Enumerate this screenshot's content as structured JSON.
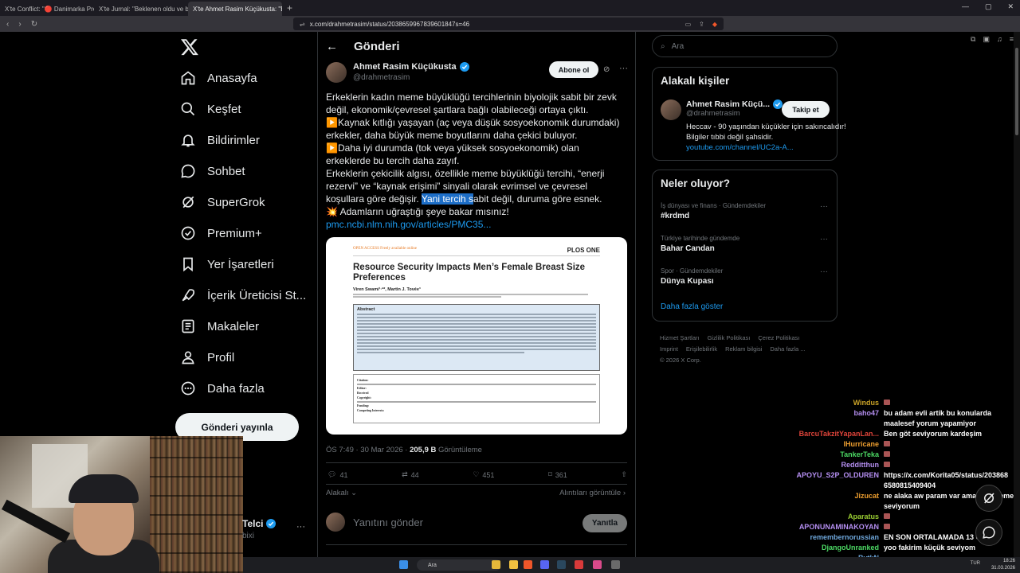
{
  "browser": {
    "tabs": [
      {
        "label": "X'te Conflict: \"🔴 Danimarka Prenses..."
      },
      {
        "label": "X'te Jurnal: \"Beklenen oldu ve buza..."
      },
      {
        "label": "X'te Ahmet Rasim Küçükusta: \"E..."
      }
    ],
    "url": "x.com/drahmetrasim/status/2038659967839601847s=46"
  },
  "sidebar": {
    "items": [
      {
        "label": "Anasayfa",
        "icon": "home-icon"
      },
      {
        "label": "Keşfet",
        "icon": "search-icon"
      },
      {
        "label": "Bildirimler",
        "icon": "bell-icon"
      },
      {
        "label": "Sohbet",
        "icon": "chat-icon"
      },
      {
        "label": "SuperGrok",
        "icon": "grok-icon"
      },
      {
        "label": "Premium+",
        "icon": "premium-icon"
      },
      {
        "label": "Yer İşaretleri",
        "icon": "bookmark-icon"
      },
      {
        "label": "İçerik Üreticisi St...",
        "icon": "rocket-icon"
      },
      {
        "label": "Makaleler",
        "icon": "article-icon"
      },
      {
        "label": "Profil",
        "icon": "person-icon"
      },
      {
        "label": "Daha fazla",
        "icon": "more-circle-icon"
      }
    ],
    "post_button": "Gönderi yayınla",
    "account_name": "Telci",
    "account_handle": "bixi"
  },
  "post": {
    "header_title": "Gönderi",
    "author_name": "Ahmet Rasim Küçükusta",
    "author_handle": "@drahmetrasim",
    "subscribe_label": "Abone ol",
    "text": {
      "p1": "Erkeklerin kadın meme büyüklüğü tercihlerinin biyolojik sabit bir zevk değil, ekonomik/çevresel şartlara bağlı olabileceği ortaya çıktı.",
      "p2": "Kaynak kıtlığı yaşayan (aç veya düşük sosyoekonomik durumdaki) erkekler, daha büyük meme boyutlarını daha çekici buluyor.",
      "p3": "Daha iyi durumda (tok veya yüksek sosyoekonomik) olan erkeklerde bu tercih daha zayıf.",
      "p4a": "Erkeklerin çekicilik algısı, özellikle meme büyüklüğü tercihi, “enerji rezervi” ve “kaynak erişimi” sinyali olarak evrimsel ve çevresel koşullara göre değişir. ",
      "p4hl": "Yani tercih s",
      "p4b": "abit değil, duruma göre esnek.",
      "p5": "Adamların uğraştığı şeye bakar mısınız!",
      "link": "pmc.ncbi.nlm.nih.gov/articles/PMC35..."
    },
    "paper": {
      "open_access": "OPEN ACCESS Freely available online",
      "journal": "PLOS ONE",
      "title": "Resource Security Impacts Men’s Female Breast Size Preferences",
      "authors": "Viren Swami¹·²*, Martin J. Tovée³",
      "abstract_heading": "Abstract",
      "meta": [
        "Citation:",
        "Editor:",
        "Received",
        "Copyright:",
        "Funding:",
        "Competing Interests:"
      ]
    },
    "timestamp": "ÖS 7:49 · 30 Mar 2026 · ",
    "views_value": "205,9 B",
    "views_label": " Görüntüleme",
    "stats": {
      "replies": "41",
      "reposts": "44",
      "likes": "451",
      "bookmarks": "361"
    },
    "relevant_label": "Alakalı",
    "quotes_label": "Alıntıları görüntüle",
    "reply_placeholder": "Yanıtını gönder",
    "reply_button": "Yanıtla"
  },
  "right": {
    "search_placeholder": "Ara",
    "relevant_title": "Alakalı kişiler",
    "person_name": "Ahmet Rasim Küçü...",
    "person_handle": "@drahmetrasim",
    "follow_label": "Takip et",
    "bio": "Heccav - 90 yaşından küçükler için sakıncalıdır! Bilgiler tıbbi değil şahsidir.",
    "bio_link": "youtube.com/channel/UC2a-A...",
    "trends_title": "Neler oluyor?",
    "trends": [
      {
        "category": "İş dünyası ve finans · Gündemdekiler",
        "title": "#krdmd"
      },
      {
        "category": "Türkiye tarihinde gündemde",
        "title": "Bahar Candan"
      },
      {
        "category": "Spor · Gündemdekiler",
        "title": "Dünya Kupası"
      }
    ],
    "show_more": "Daha fazla göster",
    "footer": [
      "Hizmet Şartları",
      "Gizlilik Politikası",
      "Çerez Politikası",
      "Imprint",
      "Erişilebilirlik",
      "Reklam bilgisi",
      "Daha fazla ...",
      "© 2026 X Corp."
    ]
  },
  "chat": [
    {
      "user": "Windus",
      "msg": "",
      "color": "#c9a227",
      "emote": true
    },
    {
      "user": "baho47",
      "msg": "bu adam evli artik bu konularda maalesef yorum yapamiyor",
      "color": "#b48ef0"
    },
    {
      "user": "BarcuTakzitYapanLan...",
      "msg": "Ben göt seviyorum kardeşim",
      "color": "#e0443a"
    },
    {
      "user": "lHurricane",
      "msg": "",
      "color": "#f0a030",
      "emote": true
    },
    {
      "user": "TankerTeka",
      "msg": "",
      "color": "#4cd964",
      "emote": true
    },
    {
      "user": "Redditthun",
      "msg": "",
      "color": "#b48ef0",
      "emote": true
    },
    {
      "user": "APOYU_S2P_OLDUREN",
      "msg": "https://x.com/Korita05/status/203868 6580815409404",
      "color": "#b48ef0"
    },
    {
      "user": "Jizucat",
      "msg": "ne alaka aw param var ama ben meme seviyorum",
      "color": "#f0a030"
    },
    {
      "user": "Aparatus",
      "msg": "",
      "color": "#9acd32",
      "emote": true
    },
    {
      "user": "APONUNAMINAKOYAN",
      "msg": "",
      "color": "#b48ef0",
      "emote": true
    },
    {
      "user": "remembernorussian",
      "msg": "EN SON ORTALAMADA 13 CM İDİ",
      "color": "#6fa8dc"
    },
    {
      "user": "DjangoUnranked",
      "msg": "yoo fakirim küçük seviyom",
      "color": "#4cd964"
    },
    {
      "user": "BytkN",
      "msg": "",
      "color": "#6fa8dc"
    }
  ],
  "taskbar": {
    "search": "Ara",
    "time": "18:26",
    "date": "31.03.2026",
    "lang": "TUR"
  }
}
